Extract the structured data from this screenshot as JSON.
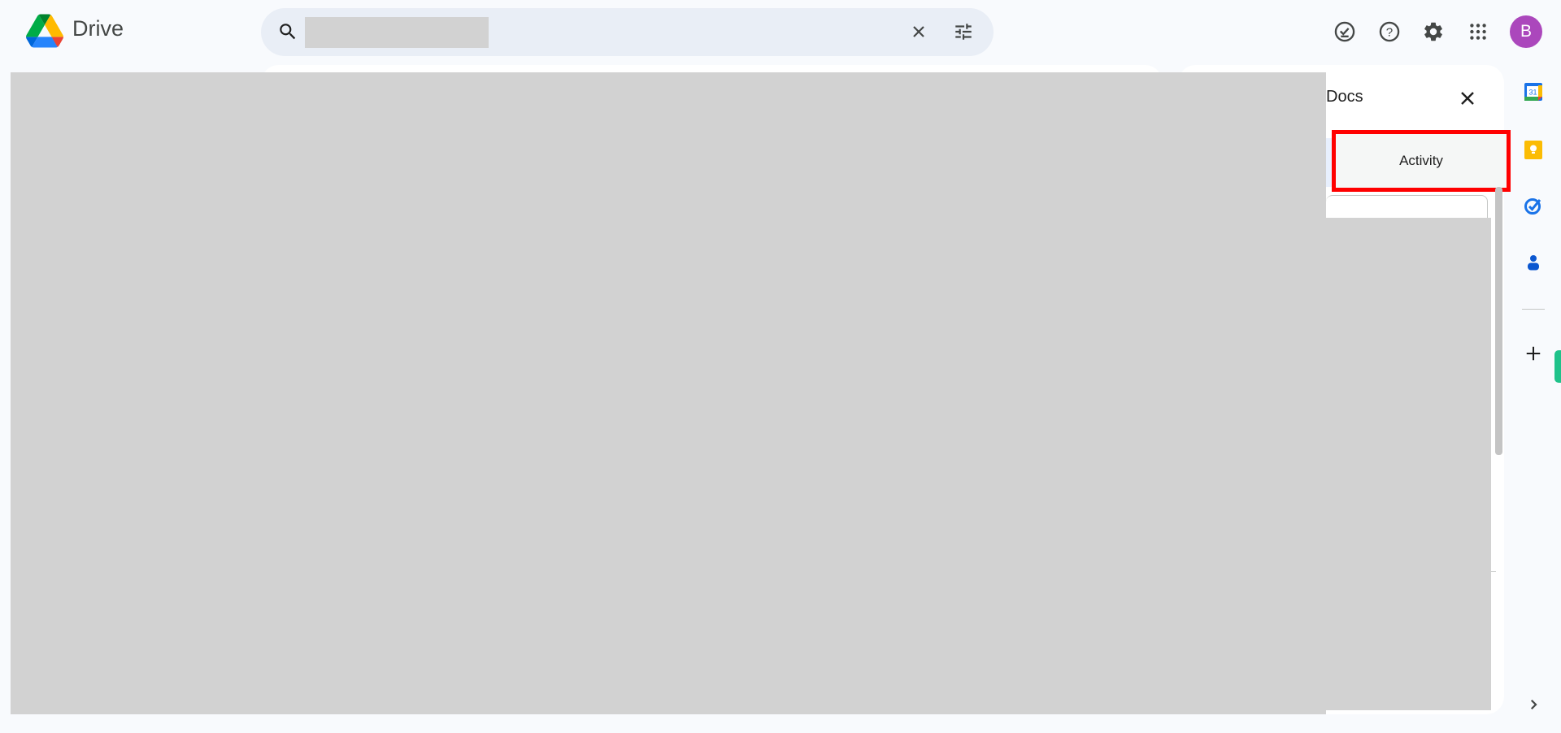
{
  "header": {
    "app_name": "Drive",
    "search": {
      "placeholder": ""
    },
    "avatar_letter": "B"
  },
  "icons": {
    "search": "search-icon",
    "clear": "close-icon",
    "filter": "tune-icon",
    "offline": "offline-ready-icon",
    "help": "help-icon",
    "settings": "gear-icon",
    "apps": "apps-grid-icon"
  },
  "details_panel": {
    "title_partial": "Docs",
    "tabs": [
      {
        "label": "Activity",
        "selected": false,
        "highlighted": true
      }
    ]
  },
  "colors": {
    "avatar": "#ab47bc",
    "highlight": "#ff0000",
    "background": "#f8fafd"
  },
  "side_panel": {
    "apps": [
      "calendar-icon",
      "keep-icon",
      "tasks-icon",
      "contacts-icon"
    ],
    "calendar_day": "31"
  }
}
